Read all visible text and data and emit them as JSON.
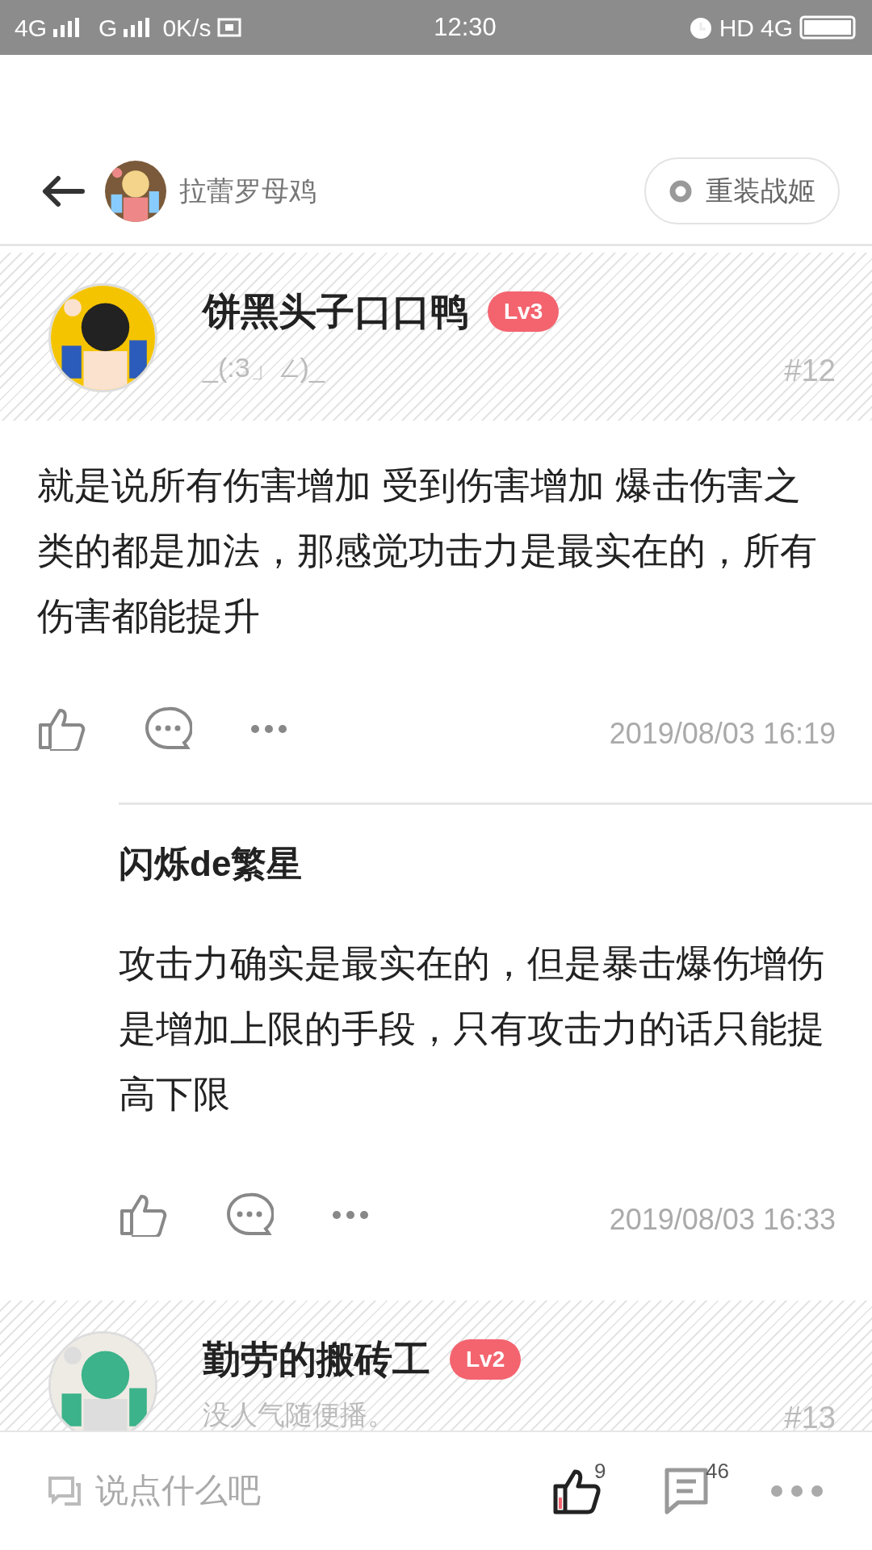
{
  "status_bar": {
    "network_1": "4G",
    "network_2": "G",
    "speed": "0K/s",
    "time": "12:30",
    "hd": "HD",
    "network_3": "4G"
  },
  "header": {
    "title": "拉蕾罗母鸡",
    "tag_button": "重装战姬"
  },
  "posts": [
    {
      "author": "饼黑头子口口鸭",
      "level": "Lv3",
      "signature": "_(:3」∠)_",
      "floor": "#12",
      "body": "就是说所有伤害增加 受到伤害增加 爆击伤害之类的都是加法，那感觉功击力是最实在的，所有伤害都能提升",
      "time": "2019/08/03 16:19",
      "replies": [
        {
          "author": "闪烁de繁星",
          "body": "攻击力确实是最实在的，但是暴击爆伤增伤是增加上限的手段，只有攻击力的话只能提高下限",
          "time": "2019/08/03 16:33"
        }
      ]
    },
    {
      "author": "勤劳的搬砖工",
      "level": "Lv2",
      "signature": "没人气随便播。",
      "floor": "#13"
    }
  ],
  "bottom_bar": {
    "placeholder": "说点什么吧",
    "likes": "9",
    "comments": "46"
  }
}
